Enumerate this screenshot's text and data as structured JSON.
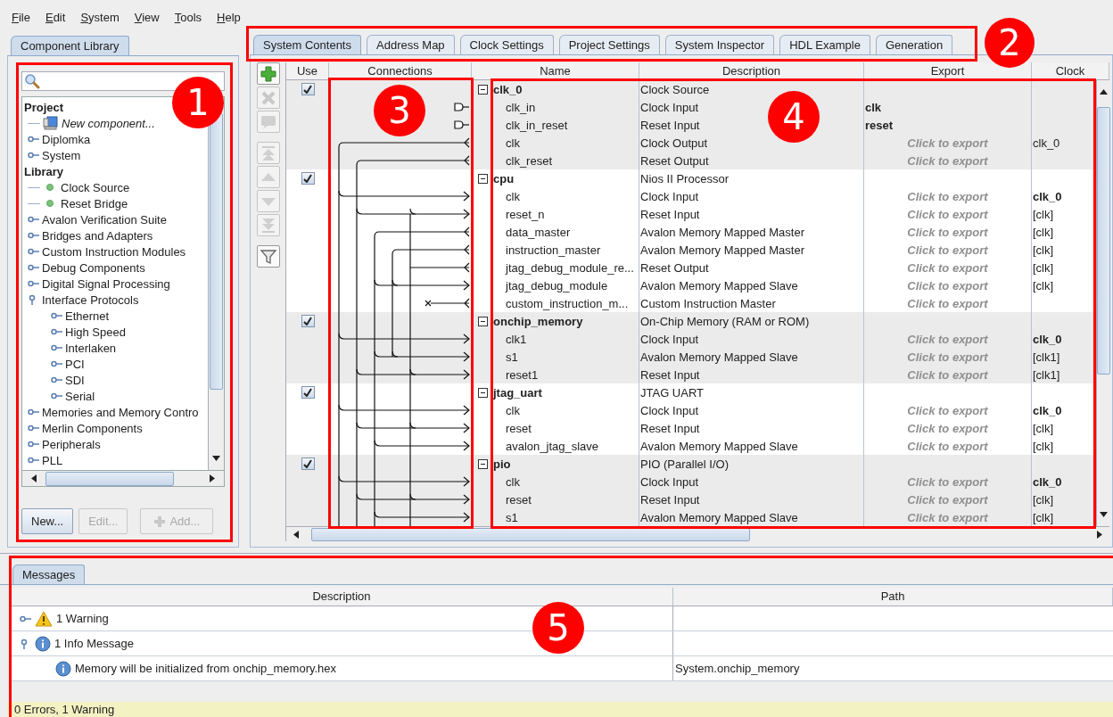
{
  "menu": [
    {
      "label": "File"
    },
    {
      "label": "Edit"
    },
    {
      "label": "System"
    },
    {
      "label": "View"
    },
    {
      "label": "Tools"
    },
    {
      "label": "Help"
    }
  ],
  "library": {
    "tab": {
      "label": "Component Library",
      "selected": true
    },
    "tree": [
      {
        "label": "Project",
        "kind": "header",
        "children": [
          {
            "label": "New component...",
            "kind": "new"
          },
          {
            "label": "Diplomka",
            "kind": "category",
            "expanded": false
          },
          {
            "label": "System",
            "kind": "category",
            "expanded": false
          }
        ]
      },
      {
        "label": "Library",
        "kind": "header",
        "children": [
          {
            "label": "Clock Source",
            "kind": "component"
          },
          {
            "label": "Reset Bridge",
            "kind": "component"
          },
          {
            "label": "Avalon Verification Suite",
            "kind": "category",
            "expanded": false
          },
          {
            "label": "Bridges and Adapters",
            "kind": "category",
            "expanded": false
          },
          {
            "label": "Custom Instruction Modules",
            "kind": "category",
            "expanded": false
          },
          {
            "label": "Debug Components",
            "kind": "category",
            "expanded": false
          },
          {
            "label": "Digital Signal Processing",
            "kind": "category",
            "expanded": false
          },
          {
            "label": "Interface Protocols",
            "kind": "category",
            "expanded": true,
            "children": [
              {
                "label": "Ethernet",
                "kind": "category",
                "expanded": false
              },
              {
                "label": "High Speed",
                "kind": "category",
                "expanded": false
              },
              {
                "label": "Interlaken",
                "kind": "category",
                "expanded": false
              },
              {
                "label": "PCI",
                "kind": "category",
                "expanded": false
              },
              {
                "label": "SDI",
                "kind": "category",
                "expanded": false
              },
              {
                "label": "Serial",
                "kind": "category",
                "expanded": false
              }
            ]
          },
          {
            "label": "Memories and Memory Contro",
            "kind": "category",
            "expanded": false
          },
          {
            "label": "Merlin Components",
            "kind": "category",
            "expanded": false
          },
          {
            "label": "Peripherals",
            "kind": "category",
            "expanded": false
          },
          {
            "label": "PLL",
            "kind": "category",
            "expanded": false
          }
        ]
      }
    ],
    "buttons": [
      {
        "label": "New...",
        "kind": "plain",
        "disabled": false
      },
      {
        "label": "Edit...",
        "kind": "plain",
        "disabled": true
      },
      {
        "label": "Add...",
        "kind": "add",
        "disabled": true
      }
    ]
  },
  "tabs": [
    {
      "label": "System Contents",
      "selected": true
    },
    {
      "label": "Address Map",
      "selected": false
    },
    {
      "label": "Clock Settings",
      "selected": false
    },
    {
      "label": "Project Settings",
      "selected": false
    },
    {
      "label": "System Inspector",
      "selected": false
    },
    {
      "label": "HDL Example",
      "selected": false
    },
    {
      "label": "Generation",
      "selected": false
    }
  ],
  "toolbar": [
    {
      "kind": "add",
      "disabled": false
    },
    {
      "kind": "remove",
      "disabled": true
    },
    {
      "kind": "edit",
      "disabled": true
    },
    {
      "kind": "top",
      "disabled": true
    },
    {
      "kind": "up",
      "disabled": true
    },
    {
      "kind": "down",
      "disabled": true
    },
    {
      "kind": "bottom",
      "disabled": true
    },
    {
      "kind": "filter",
      "disabled": false
    }
  ],
  "table": {
    "columns": [
      "Use",
      "Connections",
      "Name",
      "Description",
      "Export",
      "Clock"
    ],
    "modules": [
      {
        "name": "clk_0",
        "description": "Clock Source",
        "use": true,
        "expanded": true,
        "ports": [
          {
            "name": "clk_in",
            "description": "Clock Input",
            "export": {
              "text": "clk",
              "exported": true
            }
          },
          {
            "name": "clk_in_reset",
            "description": "Reset Input",
            "export": {
              "text": "reset",
              "exported": true
            }
          },
          {
            "name": "clk",
            "description": "Clock Output",
            "export": {
              "text": "Click to export",
              "exported": false
            },
            "clock": {
              "text": "clk_0",
              "bold": false
            }
          },
          {
            "name": "clk_reset",
            "description": "Reset Output",
            "export": {
              "text": "Click to export",
              "exported": false
            }
          }
        ]
      },
      {
        "name": "cpu",
        "description": "Nios II Processor",
        "use": true,
        "expanded": true,
        "ports": [
          {
            "name": "clk",
            "description": "Clock Input",
            "export": {
              "text": "Click to export",
              "exported": false
            },
            "clock": {
              "text": "clk_0",
              "bold": true
            }
          },
          {
            "name": "reset_n",
            "description": "Reset Input",
            "export": {
              "text": "Click to export",
              "exported": false
            },
            "clock": {
              "text": "[clk]",
              "bold": false
            }
          },
          {
            "name": "data_master",
            "description": "Avalon Memory Mapped Master",
            "export": {
              "text": "Click to export",
              "exported": false
            },
            "clock": {
              "text": "[clk]",
              "bold": false
            }
          },
          {
            "name": "instruction_master",
            "description": "Avalon Memory Mapped Master",
            "export": {
              "text": "Click to export",
              "exported": false
            },
            "clock": {
              "text": "[clk]",
              "bold": false
            }
          },
          {
            "name": "jtag_debug_module_re...",
            "description": "Reset Output",
            "export": {
              "text": "Click to export",
              "exported": false
            },
            "clock": {
              "text": "[clk]",
              "bold": false
            }
          },
          {
            "name": "jtag_debug_module",
            "description": "Avalon Memory Mapped Slave",
            "export": {
              "text": "Click to export",
              "exported": false
            },
            "clock": {
              "text": "[clk]",
              "bold": false
            }
          },
          {
            "name": "custom_instruction_m...",
            "description": "Custom Instruction Master",
            "export": {
              "text": "Click to export",
              "exported": false
            }
          }
        ]
      },
      {
        "name": "onchip_memory",
        "description": "On-Chip Memory (RAM or ROM)",
        "use": true,
        "expanded": true,
        "ports": [
          {
            "name": "clk1",
            "description": "Clock Input",
            "export": {
              "text": "Click to export",
              "exported": false
            },
            "clock": {
              "text": "clk_0",
              "bold": true
            }
          },
          {
            "name": "s1",
            "description": "Avalon Memory Mapped Slave",
            "export": {
              "text": "Click to export",
              "exported": false
            },
            "clock": {
              "text": "[clk1]",
              "bold": false
            }
          },
          {
            "name": "reset1",
            "description": "Reset Input",
            "export": {
              "text": "Click to export",
              "exported": false
            },
            "clock": {
              "text": "[clk1]",
              "bold": false
            }
          }
        ]
      },
      {
        "name": "jtag_uart",
        "description": "JTAG UART",
        "use": true,
        "expanded": true,
        "ports": [
          {
            "name": "clk",
            "description": "Clock Input",
            "export": {
              "text": "Click to export",
              "exported": false
            },
            "clock": {
              "text": "clk_0",
              "bold": true
            }
          },
          {
            "name": "reset",
            "description": "Reset Input",
            "export": {
              "text": "Click to export",
              "exported": false
            },
            "clock": {
              "text": "[clk]",
              "bold": false
            }
          },
          {
            "name": "avalon_jtag_slave",
            "description": "Avalon Memory Mapped Slave",
            "export": {
              "text": "Click to export",
              "exported": false
            },
            "clock": {
              "text": "[clk]",
              "bold": false
            }
          }
        ]
      },
      {
        "name": "pio",
        "description": "PIO (Parallel I/O)",
        "use": true,
        "expanded": true,
        "ports": [
          {
            "name": "clk",
            "description": "Clock Input",
            "export": {
              "text": "Click to export",
              "exported": false
            },
            "clock": {
              "text": "clk_0",
              "bold": true
            }
          },
          {
            "name": "reset",
            "description": "Reset Input",
            "export": {
              "text": "Click to export",
              "exported": false
            },
            "clock": {
              "text": "[clk]",
              "bold": false
            }
          },
          {
            "name": "s1",
            "description": "Avalon Memory Mapped Slave",
            "export": {
              "text": "Click to export",
              "exported": false
            },
            "clock": {
              "text": "[clk]",
              "bold": false
            }
          }
        ]
      }
    ]
  },
  "messages": {
    "tab": {
      "label": "Messages",
      "selected": true
    },
    "columns": [
      "Description",
      "Path"
    ],
    "rows": [
      {
        "label": "1 Warning",
        "kind": "warning",
        "expanded": false
      },
      {
        "label": "1 Info Message",
        "kind": "info",
        "expanded": true,
        "children": [
          {
            "label": "Memory will be initialized from onchip_memory.hex",
            "kind": "info",
            "path": "System.onchip_memory"
          }
        ]
      }
    ],
    "status": "0 Errors, 1 Warning"
  },
  "callouts": [
    {
      "number": "1"
    },
    {
      "number": "2"
    },
    {
      "number": "3"
    },
    {
      "number": "4"
    },
    {
      "number": "5"
    }
  ]
}
